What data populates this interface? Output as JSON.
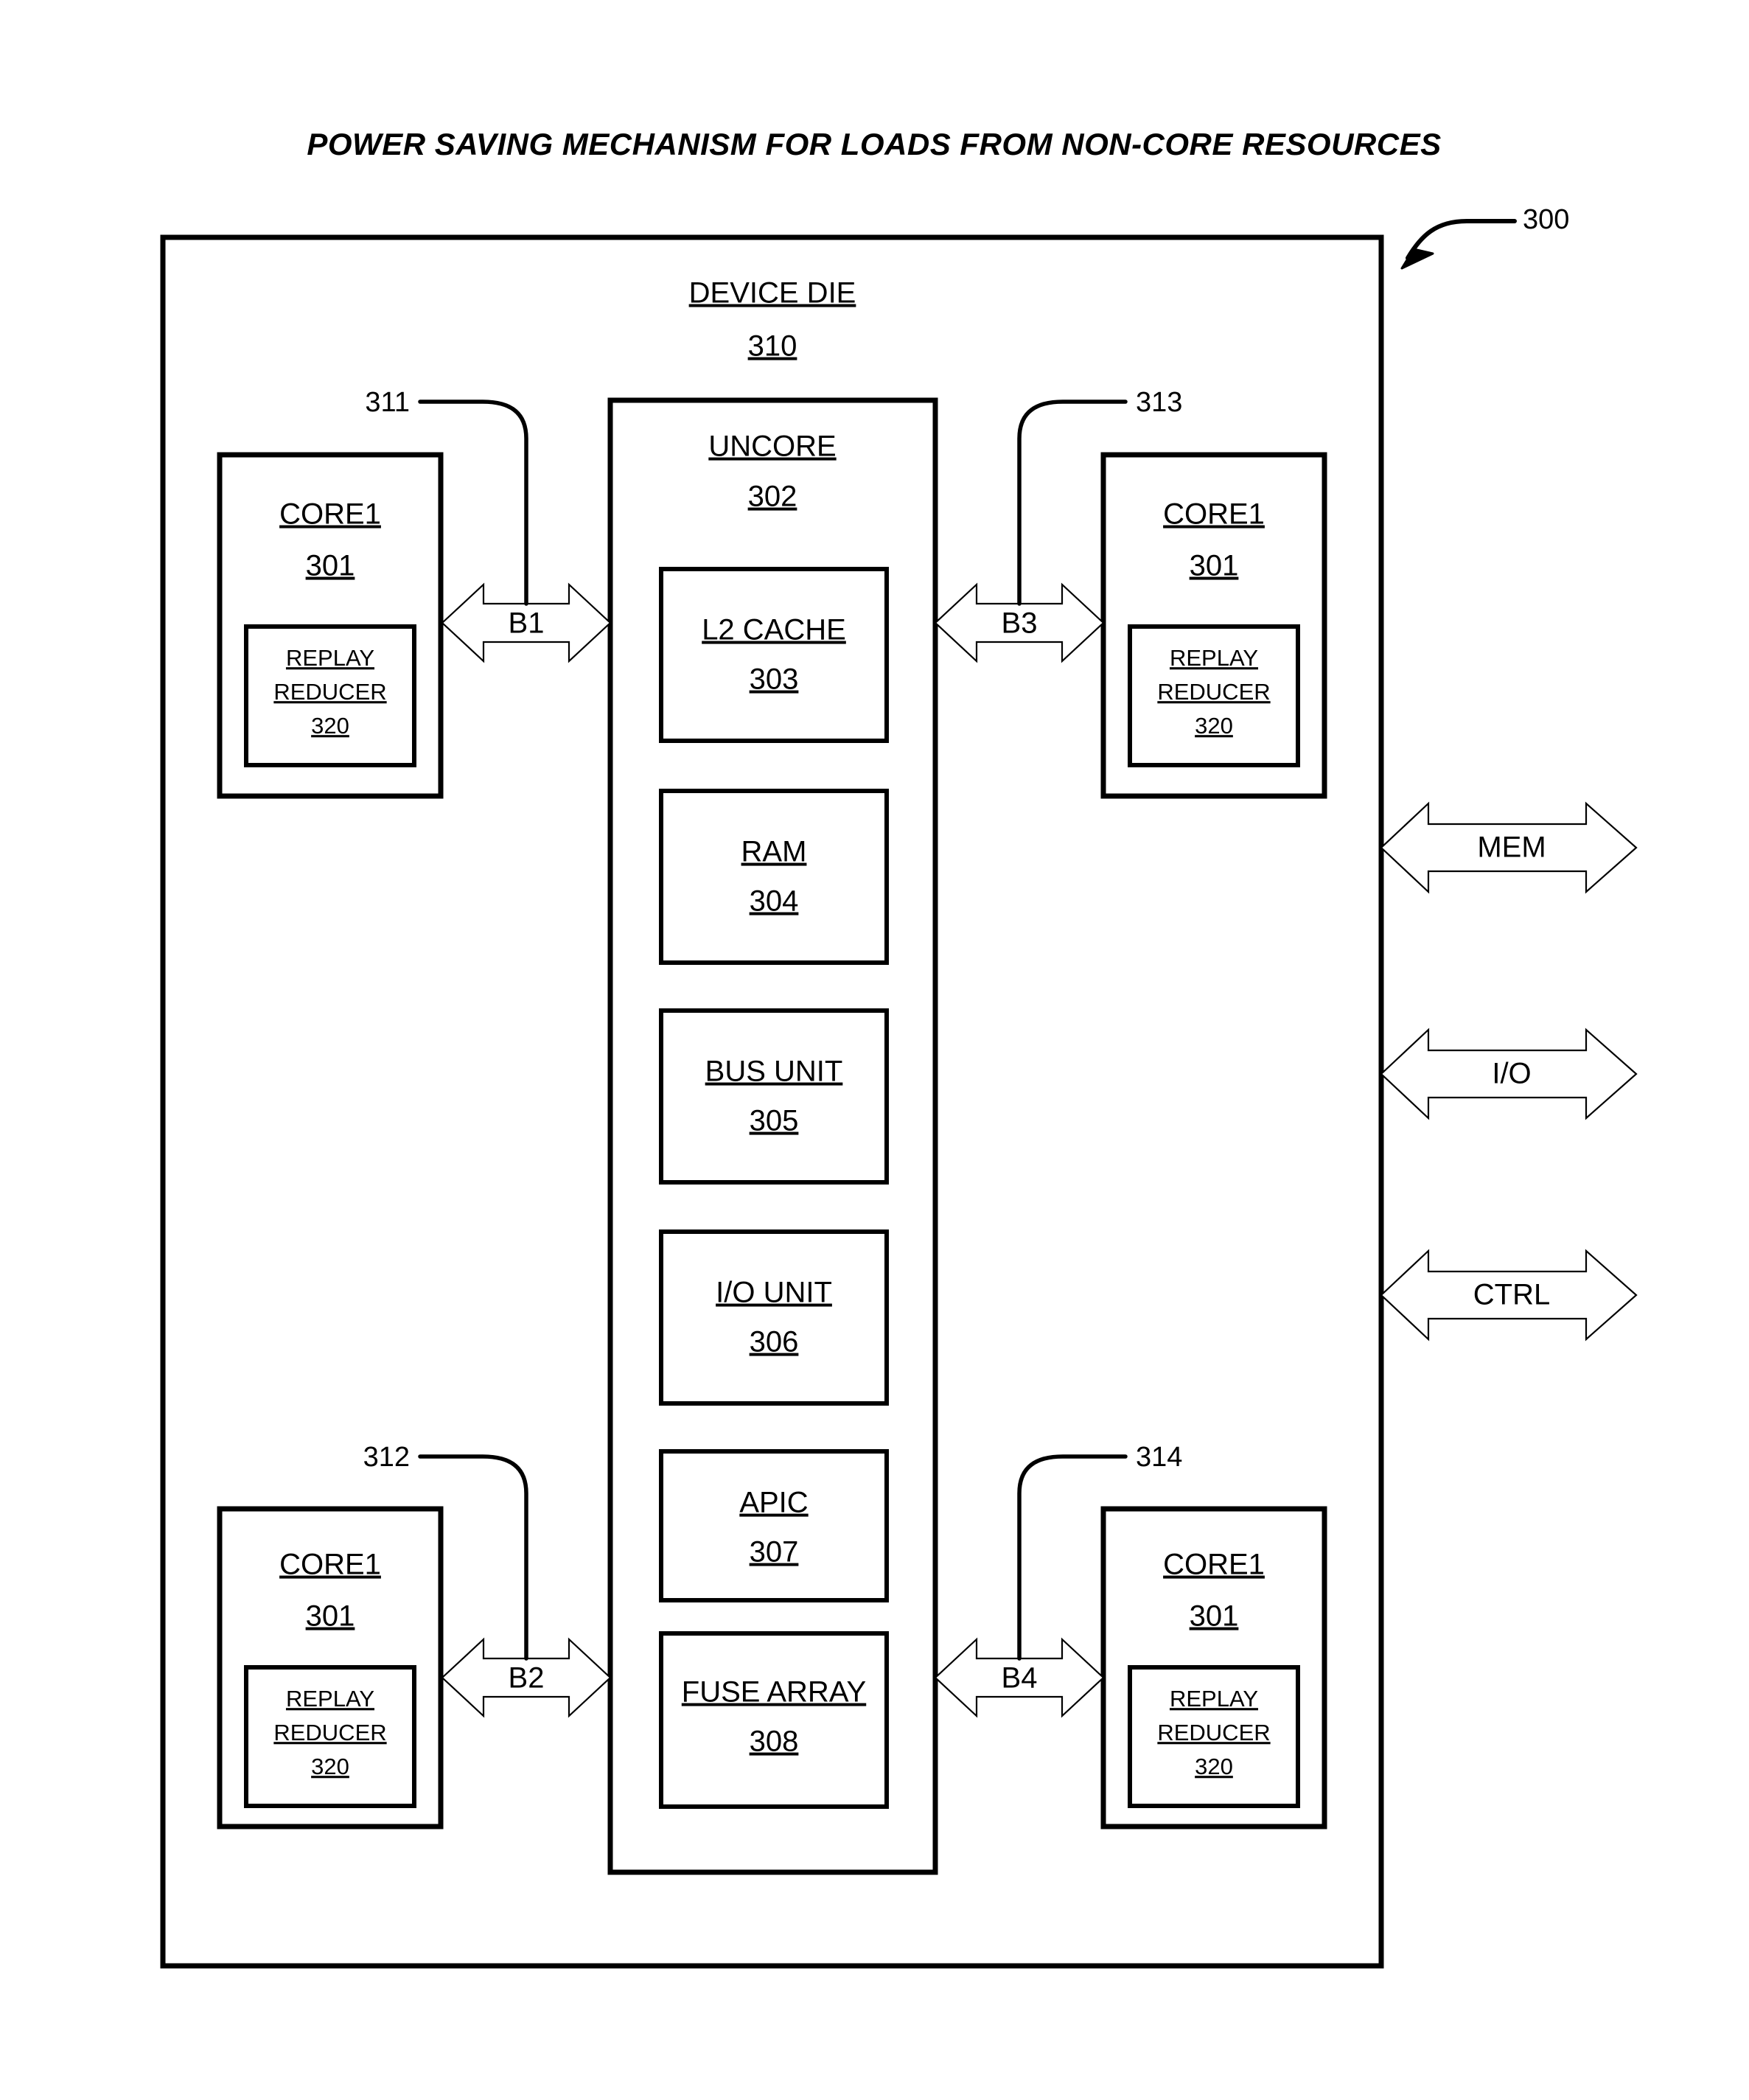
{
  "figure": {
    "title": "POWER SAVING MECHANISM FOR LOADS FROM NON-CORE RESOURCES",
    "figure_ref": "300"
  },
  "die": {
    "label": "DEVICE DIE",
    "ref": "310"
  },
  "uncore": {
    "label": "UNCORE",
    "ref": "302",
    "blocks": [
      {
        "label": "L2 CACHE",
        "ref": "303"
      },
      {
        "label": "RAM",
        "ref": "304"
      },
      {
        "label": "BUS UNIT",
        "ref": "305"
      },
      {
        "label": "I/O UNIT",
        "ref": "306"
      },
      {
        "label": "APIC",
        "ref": "307"
      },
      {
        "label": "FUSE ARRAY",
        "ref": "308"
      }
    ]
  },
  "cores": [
    {
      "position": "top-left",
      "label": "CORE1",
      "ref": "301",
      "inner": {
        "line1": "REPLAY",
        "line2": "REDUCER",
        "ref": "320"
      }
    },
    {
      "position": "top-right",
      "label": "CORE1",
      "ref": "301",
      "inner": {
        "line1": "REPLAY",
        "line2": "REDUCER",
        "ref": "320"
      }
    },
    {
      "position": "bottom-left",
      "label": "CORE1",
      "ref": "301",
      "inner": {
        "line1": "REPLAY",
        "line2": "REDUCER",
        "ref": "320"
      }
    },
    {
      "position": "bottom-right",
      "label": "CORE1",
      "ref": "301",
      "inner": {
        "line1": "REPLAY",
        "line2": "REDUCER",
        "ref": "320"
      }
    }
  ],
  "buses": [
    {
      "label": "B1",
      "ref": "311",
      "position": "top-left"
    },
    {
      "label": "B2",
      "ref": "312",
      "position": "bottom-left"
    },
    {
      "label": "B3",
      "ref": "313",
      "position": "top-right"
    },
    {
      "label": "B4",
      "ref": "314",
      "position": "bottom-right"
    }
  ],
  "external_interfaces": [
    {
      "label": "MEM"
    },
    {
      "label": "I/O"
    },
    {
      "label": "CTRL"
    }
  ],
  "colors": {
    "ink": "#000000",
    "paper": "#ffffff"
  }
}
